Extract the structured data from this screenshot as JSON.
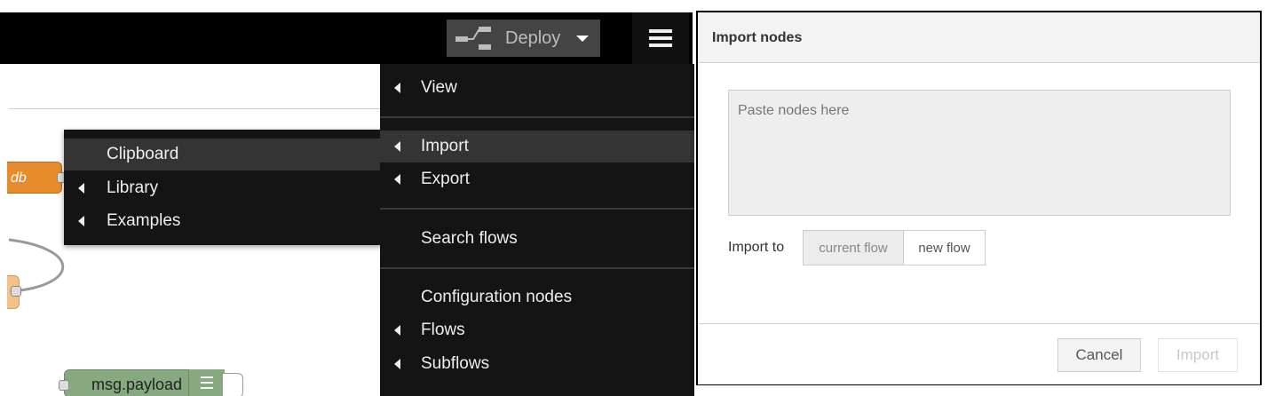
{
  "header": {
    "deploy_label": "Deploy"
  },
  "canvas": {
    "nodes": {
      "db_label": "db",
      "debug_label": "msg.payload"
    }
  },
  "main_menu": {
    "items": {
      "view": "View",
      "import": "Import",
      "export": "Export",
      "search_flows": "Search flows",
      "configuration_nodes": "Configuration nodes",
      "flows": "Flows",
      "subflows": "Subflows"
    }
  },
  "import_submenu": {
    "items": {
      "clipboard": "Clipboard",
      "library": "Library",
      "examples": "Examples"
    }
  },
  "import_dialog": {
    "title": "Import nodes",
    "paste_placeholder": "Paste nodes here",
    "import_to_label": "Import to",
    "current_flow": "current flow",
    "new_flow": "new flow",
    "cancel": "Cancel",
    "import": "Import"
  },
  "colors": {
    "toolbar": "#000000",
    "menu_bg": "#141414",
    "menu_active": "#343434",
    "db_node": "#e68c2d",
    "debug_node": "#87a980"
  }
}
